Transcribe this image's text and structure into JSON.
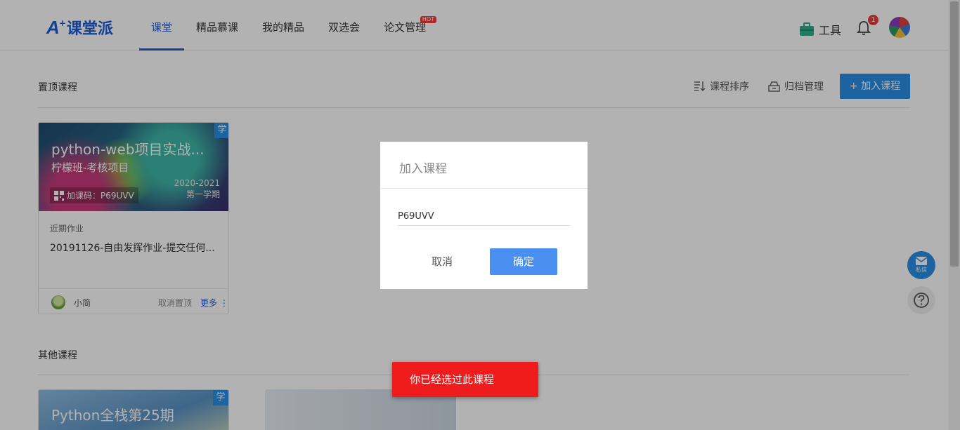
{
  "header": {
    "logo_text": "课堂派",
    "nav": [
      {
        "label": "课堂",
        "active": true
      },
      {
        "label": "精品慕课"
      },
      {
        "label": "我的精品"
      },
      {
        "label": "双选会"
      },
      {
        "label": "论文管理",
        "badge": "HOT"
      }
    ],
    "tools_label": "工具",
    "notification_count": "1"
  },
  "pinned": {
    "title": "置顶课程",
    "sort_label": "课程排序",
    "archive_label": "归档管理",
    "join_label": "+ 加入课程"
  },
  "course_card": {
    "tag": "学",
    "title": "python-web项目实战...",
    "subtitle": "柠檬班-考核项目",
    "code_label": "加课码：P69UVV",
    "year": "2020-2021",
    "term": "第一学期",
    "recent_label": "近期作业",
    "homework": "20191126-自由发挥作业-提交任何...",
    "owner": "小简",
    "unpin_label": "取消置顶",
    "more_label": "更多"
  },
  "other": {
    "title": "其他课程",
    "card_tag": "学",
    "card_title": "Python全栈第25期"
  },
  "float": {
    "msg_label": "私信"
  },
  "dialog": {
    "title": "加入课程",
    "input_value": "P69UVV",
    "cancel_label": "取消",
    "ok_label": "确定"
  },
  "toast": {
    "message": "你已经选过此课程"
  },
  "colors": {
    "brand": "#1e5bd8",
    "primary_button": "#2a8ee6",
    "ok_button": "#4a90f0",
    "toast": "#ee1c1c",
    "hot_badge": "#f03c3c"
  }
}
